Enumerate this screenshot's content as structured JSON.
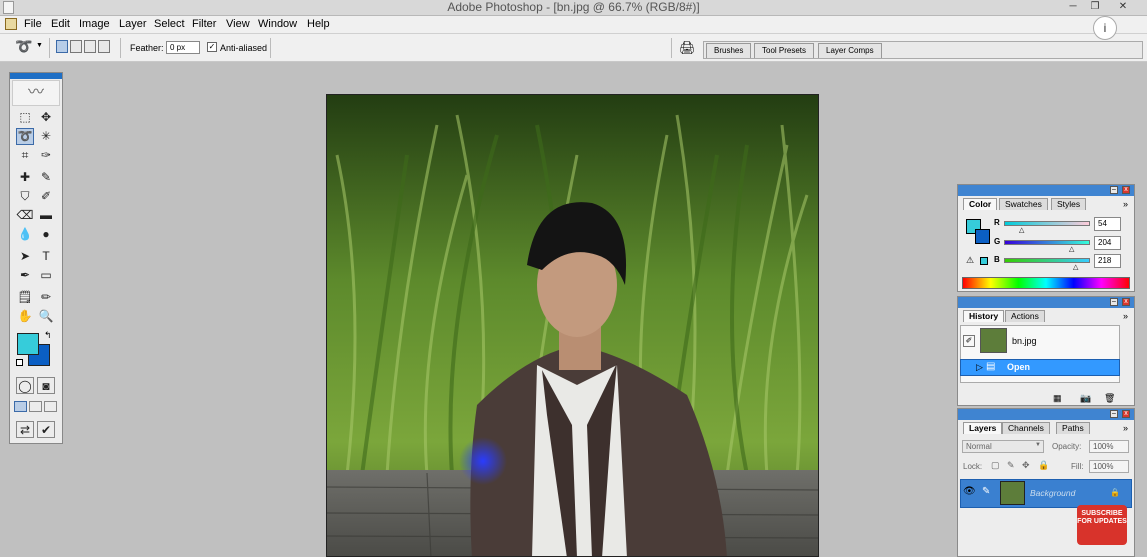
{
  "window": {
    "title": "Adobe Photoshop - [bn.jpg @ 66.7% (RGB/8#)]",
    "min_icon": "minimize-icon",
    "max_icon": "restore-icon",
    "close_icon": "close-icon"
  },
  "menu": [
    "File",
    "Edit",
    "Image",
    "Layer",
    "Select",
    "Filter",
    "View",
    "Window",
    "Help"
  ],
  "options": {
    "feather_label": "Feather:",
    "feather_value": "0 px",
    "antialiased_label": "Anti-aliased",
    "antialiased_checked": "✓",
    "wells": [
      "Brushes",
      "Tool Presets",
      "Layer Comps"
    ]
  },
  "colors": {
    "foreground": "#36ccda",
    "background": "#0b5fc4",
    "accent": "#3f84d1"
  },
  "color_panel": {
    "tabs": [
      "Color",
      "Swatches",
      "Styles"
    ],
    "r_label": "R",
    "g_label": "G",
    "b_label": "B",
    "r_value": "54",
    "g_value": "204",
    "b_value": "218"
  },
  "history_panel": {
    "tabs": [
      "History",
      "Actions"
    ],
    "snapshot": "bn.jpg",
    "states": [
      "Open"
    ]
  },
  "layers_panel": {
    "tabs": [
      "Layers",
      "Channels",
      "Paths"
    ],
    "blend_mode": "Normal",
    "opacity_label": "Opacity:",
    "opacity_value": "100%",
    "lock_label": "Lock:",
    "fill_label": "Fill:",
    "fill_value": "100%",
    "layer_name": "Background"
  },
  "overlay": {
    "subscribe": "SUBSCRIBE FOR UPDATES",
    "info": "i"
  }
}
